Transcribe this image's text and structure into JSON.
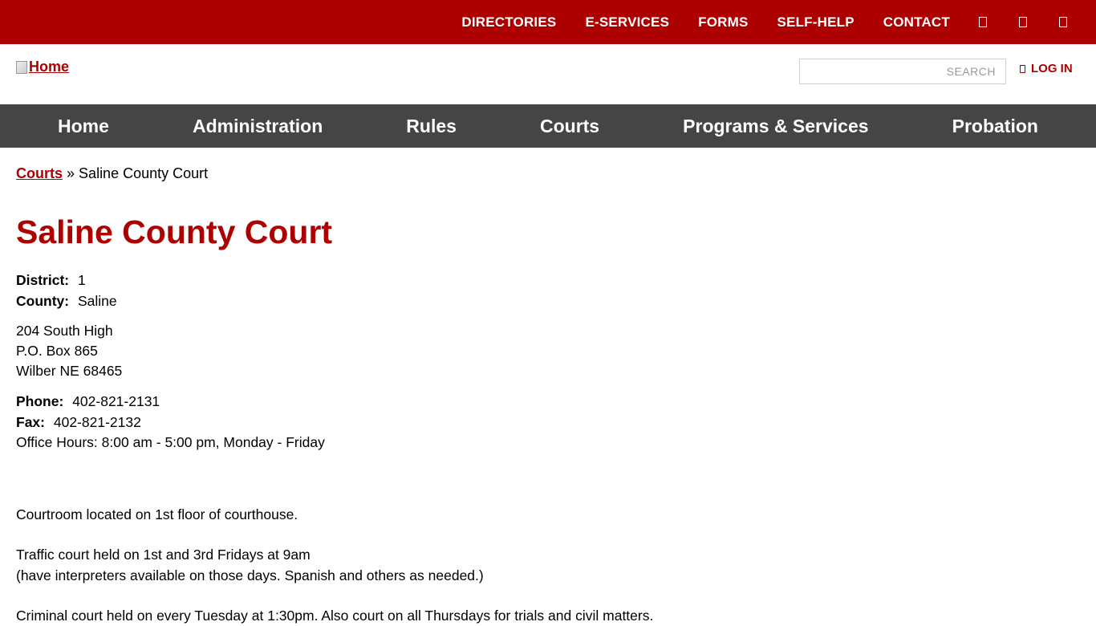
{
  "topbar": {
    "links": [
      "DIRECTORIES",
      "E-SERVICES",
      "FORMS",
      "SELF-HELP",
      "CONTACT"
    ],
    "icons": [
      "facebook-icon",
      "twitter-icon",
      "youtube-icon"
    ]
  },
  "header": {
    "logo_alt": "Home",
    "search_placeholder": "SEARCH",
    "login_label": "LOG IN"
  },
  "nav": {
    "items": [
      "Home",
      "Administration",
      "Rules",
      "Courts",
      "Programs & Services",
      "Probation"
    ]
  },
  "breadcrumb": {
    "parent": "Courts",
    "separator": "»",
    "current": "Saline County Court"
  },
  "page": {
    "title": "Saline County Court",
    "district_label": "District:",
    "district_value": "1",
    "county_label": "County:",
    "county_value": "Saline",
    "address": [
      "204 South High",
      "P.O. Box 865",
      "Wilber NE 68465"
    ],
    "phone_label": "Phone:",
    "phone_value": "402-821-2131",
    "fax_label": "Fax:",
    "fax_value": "402-821-2132",
    "office_hours": "Office Hours: 8:00 am - 5:00 pm, Monday - Friday",
    "courtroom": "Courtroom located on 1st floor of courthouse.",
    "traffic_line1": "Traffic court held on 1st and 3rd Fridays at 9am",
    "traffic_line2": "(have interpreters available on those days. Spanish and others as needed.)",
    "criminal": "Criminal court held on every Tuesday at 1:30pm. Also court on all Thursdays for trials and civil matters."
  },
  "colors": {
    "brand": "#ad0000",
    "nav_bg": "#454545"
  }
}
